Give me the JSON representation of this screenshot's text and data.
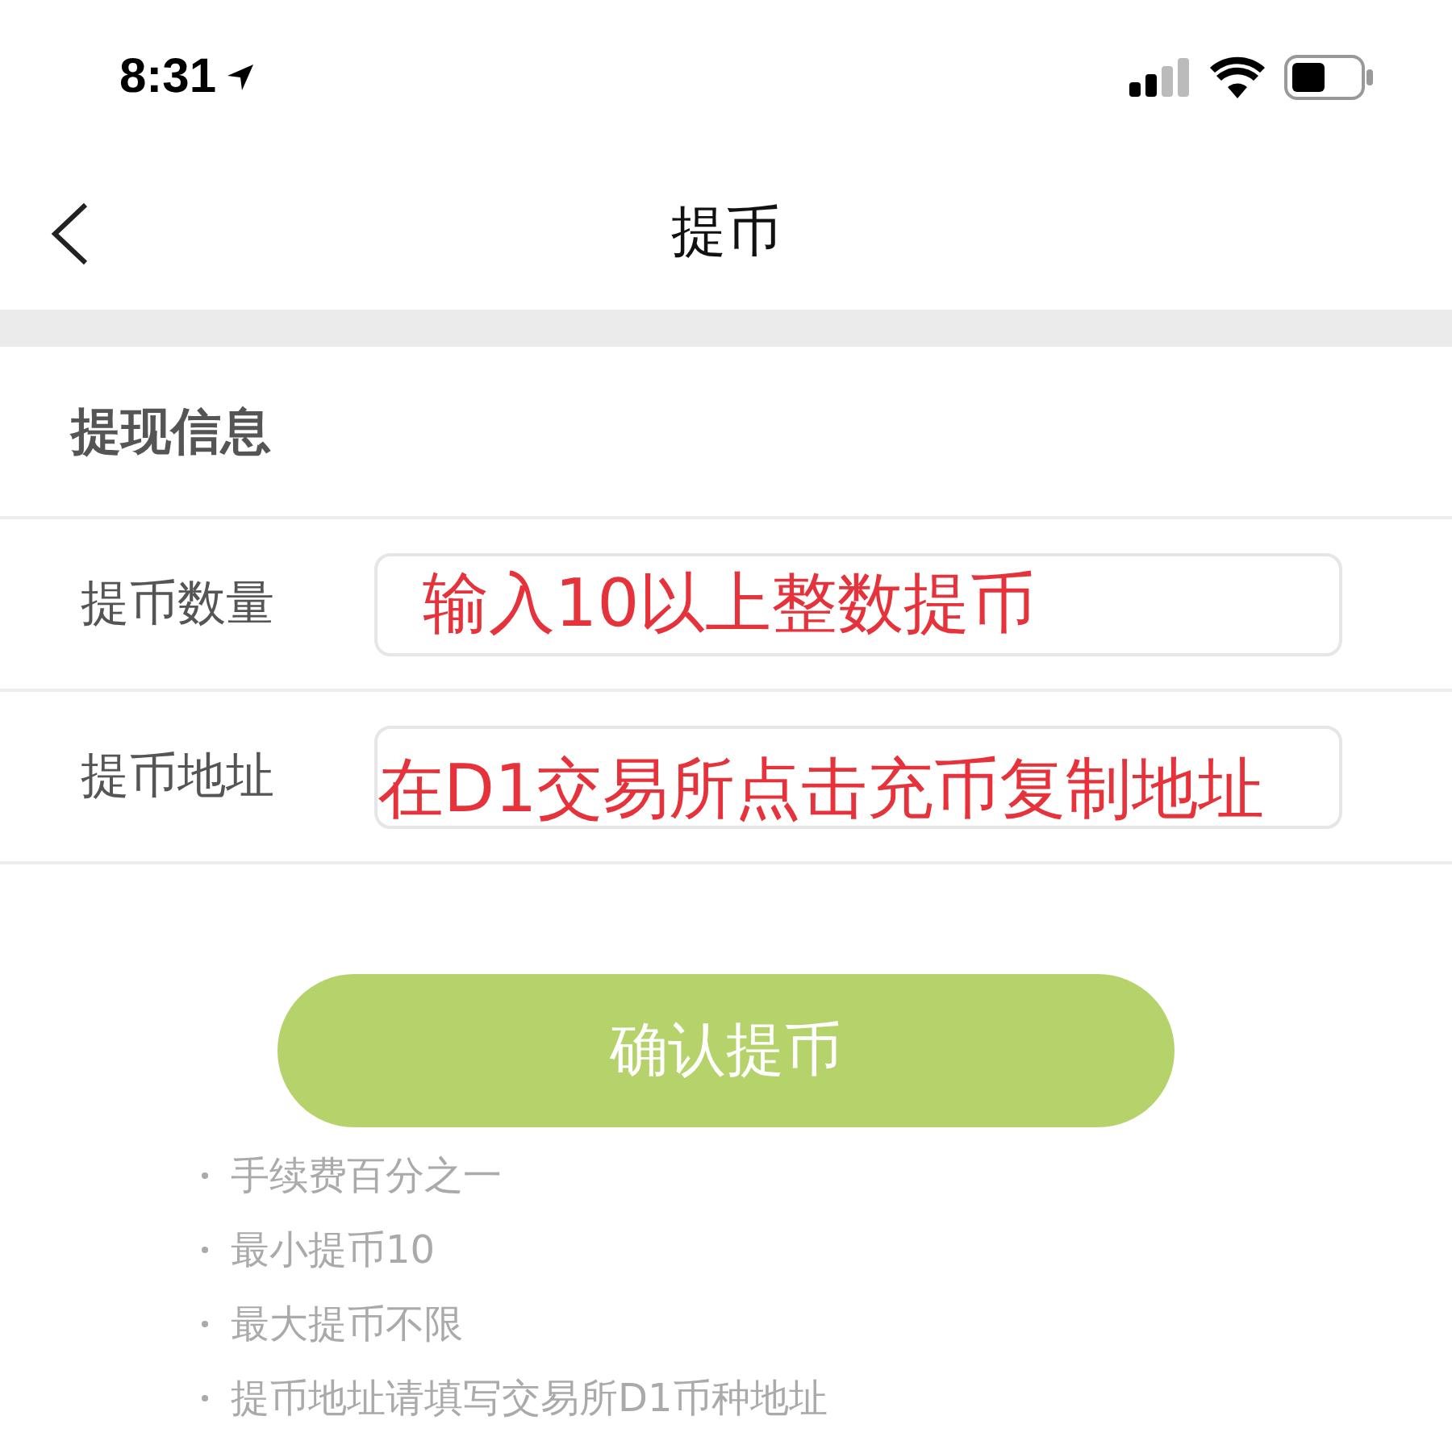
{
  "status_bar": {
    "time": "8:31"
  },
  "nav": {
    "title": "提币"
  },
  "section": {
    "title": "提现信息"
  },
  "fields": [
    {
      "label": "提币数量",
      "annotation": "输入10以上整数提币"
    },
    {
      "label": "提币地址",
      "annotation": "在D1交易所点击充币复制地址"
    }
  ],
  "submit": {
    "label": "确认提币"
  },
  "notes": [
    "手续费百分之一",
    "最小提币10",
    "最大提币不限",
    "提币地址请填写交易所D1币种地址"
  ]
}
